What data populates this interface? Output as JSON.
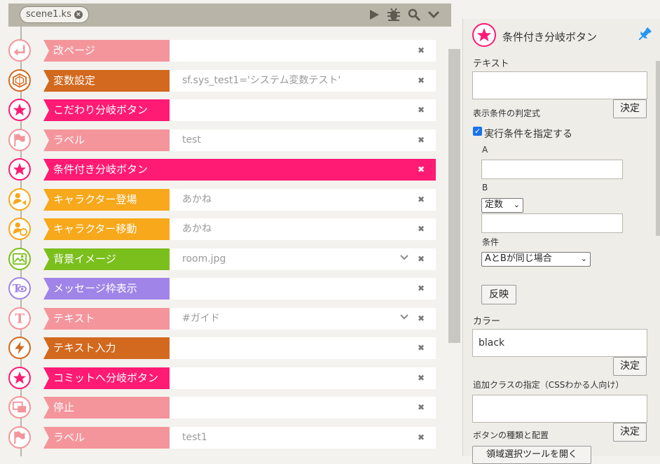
{
  "editor": {
    "tab_name": "scene1.ks",
    "tools": [
      "play-icon",
      "bug-icon",
      "search-icon",
      "chevron-down-icon"
    ]
  },
  "rows": [
    {
      "label": "改ページ",
      "value": "",
      "color": "#f4959c",
      "icon": "page-break-icon",
      "ring": "#f4959c",
      "chevron": false
    },
    {
      "label": "変数設定",
      "value": "sf.sys_test1='システム変数テスト'",
      "color": "#d2691e",
      "icon": "variable-icon",
      "ring": "#d2691e",
      "chevron": false
    },
    {
      "label": "こだわり分岐ボタン",
      "value": "",
      "color": "#ff1a74",
      "icon": "star-icon",
      "ring": "#ff1a74",
      "chevron": false
    },
    {
      "label": "ラベル",
      "value": "test",
      "color": "#f4959c",
      "icon": "flag-icon",
      "ring": "#f4959c",
      "chevron": false
    },
    {
      "label": "条件付き分岐ボタン",
      "value": "",
      "color": "#ff1a74",
      "icon": "star-icon",
      "ring": "#ff1a74",
      "chevron": false,
      "active": true
    },
    {
      "label": "キャラクター登場",
      "value": "あかね",
      "color": "#f7a81b",
      "icon": "character-enter-icon",
      "ring": "#f7a81b",
      "chevron": false
    },
    {
      "label": "キャラクター移動",
      "value": "あかね",
      "color": "#f7a81b",
      "icon": "character-move-icon",
      "ring": "#f7a81b",
      "chevron": false
    },
    {
      "label": "背景イメージ",
      "value": "room.jpg",
      "color": "#7bbf1c",
      "icon": "background-image-icon",
      "ring": "#7bbf1c",
      "chevron": true
    },
    {
      "label": "メッセージ枠表示",
      "value": "",
      "color": "#a084e8",
      "icon": "message-window-icon",
      "ring": "#a084e8",
      "chevron": false
    },
    {
      "label": "テキスト",
      "value": "#ガイド",
      "color": "#f4959c",
      "icon": "text-icon",
      "ring": "#f4959c",
      "chevron": true
    },
    {
      "label": "テキスト入力",
      "value": "",
      "color": "#d2691e",
      "icon": "lightning-icon",
      "ring": "#d2691e",
      "chevron": false
    },
    {
      "label": "コミットへ分岐ボタン",
      "value": "",
      "color": "#ff1a74",
      "icon": "star-icon",
      "ring": "#ff1a74",
      "chevron": false
    },
    {
      "label": "停止",
      "value": "",
      "color": "#f4959c",
      "icon": "stop-window-icon",
      "ring": "#f4959c",
      "chevron": false
    },
    {
      "label": "ラベル",
      "value": "test1",
      "color": "#f4959c",
      "icon": "flag-icon",
      "ring": "#f4959c",
      "chevron": false
    }
  ],
  "panel": {
    "title": "条件付き分岐ボタン",
    "text_label": "テキスト",
    "text_value": "",
    "decide_label": "決定",
    "condition_label": "表示条件の判定式",
    "checkbox_label": "実行条件を指定する",
    "a_label": "A",
    "a_value": "",
    "b_label": "B",
    "b_type": "定数",
    "b_value": "",
    "cond_label": "条件",
    "cond_value": "AとBが同じ場合",
    "reflect_label": "反映",
    "color_label": "カラー",
    "color_value": "black",
    "class_label": "追加クラスの指定（CSSわかる人向け）",
    "class_value": "",
    "layout_label": "ボタンの種類と配置",
    "region_button": "領域選択ツールを開く"
  }
}
